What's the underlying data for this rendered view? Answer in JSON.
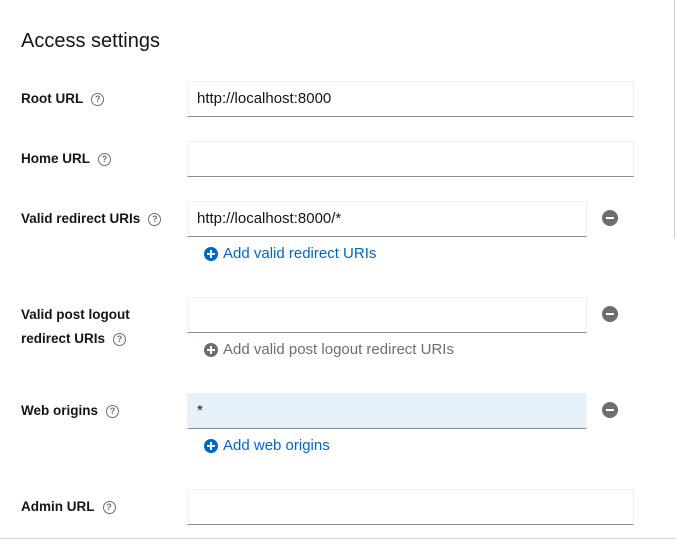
{
  "section": {
    "title": "Access settings"
  },
  "fields": {
    "root_url": {
      "label": "Root URL",
      "value": "http://localhost:8000"
    },
    "home_url": {
      "label": "Home URL",
      "value": ""
    },
    "valid_redirect": {
      "label": "Valid redirect URIs",
      "value": "http://localhost:8000/*",
      "add_label": "Add valid redirect URIs"
    },
    "post_logout": {
      "label_line1": "Valid post logout",
      "label_line2": "redirect URIs",
      "value": "",
      "add_label": "Add valid post logout redirect URIs"
    },
    "web_origins": {
      "label": "Web origins",
      "value": "*",
      "add_label": "Add web origins"
    },
    "admin_url": {
      "label": "Admin URL",
      "value": ""
    }
  },
  "help_glyph": "?",
  "colors": {
    "link": "#0066cc",
    "muted": "#6a6e73",
    "input_highlight": "#e7f1fa"
  }
}
